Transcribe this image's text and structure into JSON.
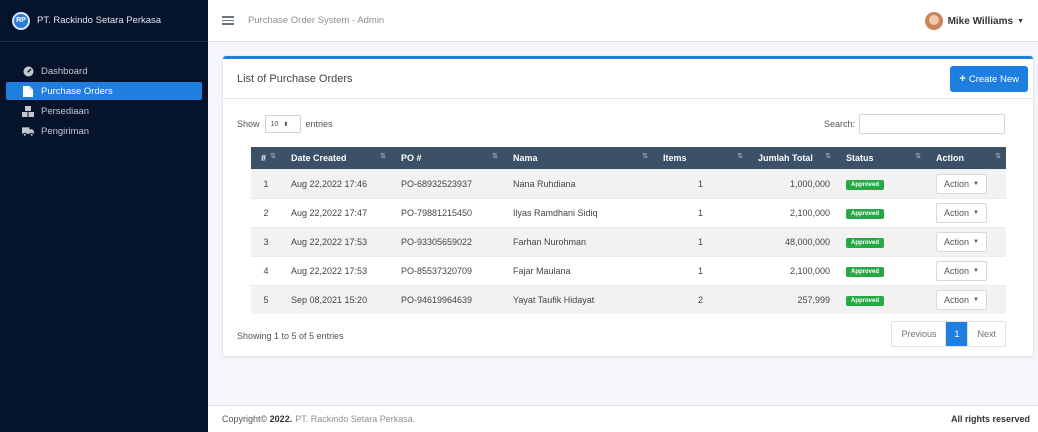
{
  "brand": {
    "logo": "RP",
    "name": "PT. Rackindo Setara Perkasa"
  },
  "sidebar": {
    "items": [
      {
        "label": "Dashboard",
        "icon": "dashboard-icon",
        "active": false
      },
      {
        "label": "Purchase Orders",
        "icon": "document-icon",
        "active": true
      },
      {
        "label": "Persediaan",
        "icon": "boxes-icon",
        "active": false
      },
      {
        "label": "Pengiriman",
        "icon": "truck-icon",
        "active": false
      }
    ]
  },
  "topbar": {
    "title": "Purchase Order System - Admin",
    "user": "Mike Williams"
  },
  "card": {
    "title": "List of Purchase Orders",
    "create_label": "Create New"
  },
  "controls": {
    "show": "Show",
    "page_size": "10",
    "entries": "entries",
    "search_label": "Search:",
    "search_value": ""
  },
  "table": {
    "headers": [
      "#",
      "Date Created",
      "PO #",
      "Nama",
      "Items",
      "Jumlah Total",
      "Status",
      "Action"
    ],
    "rows": [
      {
        "num": "1",
        "date": "Aug 22,2022 17:46",
        "po": "PO-68932523937",
        "nama": "Nana Ruhdiana",
        "items": "1",
        "total": "1,000,000",
        "status": "Approved",
        "action": "Action"
      },
      {
        "num": "2",
        "date": "Aug 22,2022 17:47",
        "po": "PO-79881215450",
        "nama": "Ilyas Ramdhani Sidiq",
        "items": "1",
        "total": "2,100,000",
        "status": "Approved",
        "action": "Action"
      },
      {
        "num": "3",
        "date": "Aug 22,2022 17:53",
        "po": "PO-93305659022",
        "nama": "Farhan Nurohman",
        "items": "1",
        "total": "48,000,000",
        "status": "Approved",
        "action": "Action"
      },
      {
        "num": "4",
        "date": "Aug 22,2022 17:53",
        "po": "PO-85537320709",
        "nama": "Fajar Maulana",
        "items": "1",
        "total": "2,100,000",
        "status": "Approved",
        "action": "Action"
      },
      {
        "num": "5",
        "date": "Sep 08,2021 15:20",
        "po": "PO-94619964639",
        "nama": "Yayat Taufik Hidayat",
        "items": "2",
        "total": "257,999",
        "status": "Approved",
        "action": "Action"
      }
    ]
  },
  "pagination": {
    "info": "Showing 1 to 5 of 5 entries",
    "previous": "Previous",
    "current": "1",
    "next": "Next"
  },
  "footer": {
    "copyright": "Copyright©",
    "year": "2022.",
    "company": "PT. Rackindo Setara Perkasa.",
    "rights": "All rights reserved"
  },
  "colors": {
    "primary": "#1f7fe0",
    "sidebar": "#06142b",
    "table_header": "#3c5068",
    "approved": "#28a745"
  }
}
